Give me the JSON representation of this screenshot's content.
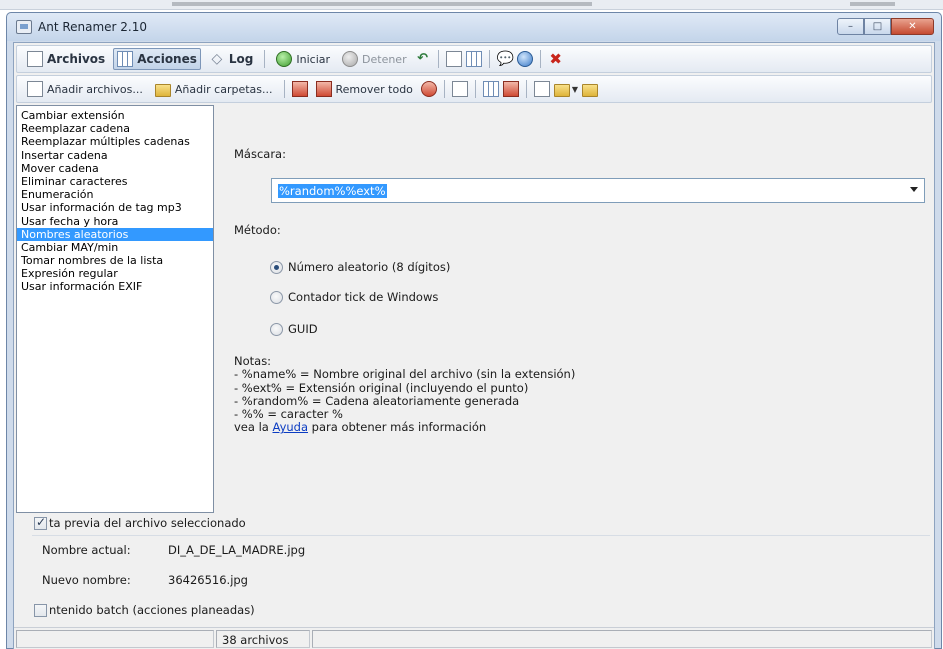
{
  "window": {
    "title": "Ant Renamer 2.10",
    "minimize_glyph": "–",
    "maximize_glyph": "□",
    "close_glyph": "✕"
  },
  "toolbar_main": {
    "archivos": "Archivos",
    "acciones": "Acciones",
    "log": "Log",
    "iniciar": "Iniciar",
    "detener": "Detener"
  },
  "toolbar_files": {
    "add_files": "Añadir archivos...",
    "add_folders": "Añadir carpetas...",
    "remove_all": "Remover todo"
  },
  "actions": {
    "items": [
      "Cambiar extensión",
      "Reemplazar cadena",
      "Reemplazar múltiples cadenas",
      "Insertar cadena",
      "Mover cadena",
      "Eliminar caracteres",
      "Enumeración",
      "Usar información de tag mp3",
      "Usar fecha y hora",
      "Nombres aleatorios",
      "Cambiar MAY/min",
      "Tomar nombres de la lista",
      "Expresión regular",
      "Usar información EXIF"
    ],
    "selected_index": 9
  },
  "options": {
    "mask_label": "Máscara:",
    "mask_value": "%random%%ext%",
    "method_label": "Método:",
    "radio_random": "Número aleatorio (8 dígitos)",
    "radio_tick": "Contador tick de Windows",
    "radio_guid": "GUID",
    "selected_method": "Número aleatorio (8 dígitos)"
  },
  "notes": {
    "title": "Notas:",
    "line1": "- %name% = Nombre original del archivo (sin la extensión)",
    "line2": "- %ext% = Extensión original (incluyendo el punto)",
    "line3": "- %random% = Cadena aleatoriamente generada",
    "line4": "- %% = caracter %",
    "help_prefix": "vea la",
    "help_link": "Ayuda",
    "help_suffix": "para obtener más información"
  },
  "preview": {
    "checkbox_label": "ta previa del archivo seleccionado",
    "checked": true,
    "current_name_label": "Nombre actual:",
    "current_name": "DI_A_DE_LA_MADRE.jpg",
    "new_name_label": "Nuevo nombre:",
    "new_name": "36426516.jpg"
  },
  "batch": {
    "checkbox_label": "ntenido batch (acciones planeadas)",
    "checked": false
  },
  "status": {
    "file_count": "38 archivos"
  }
}
